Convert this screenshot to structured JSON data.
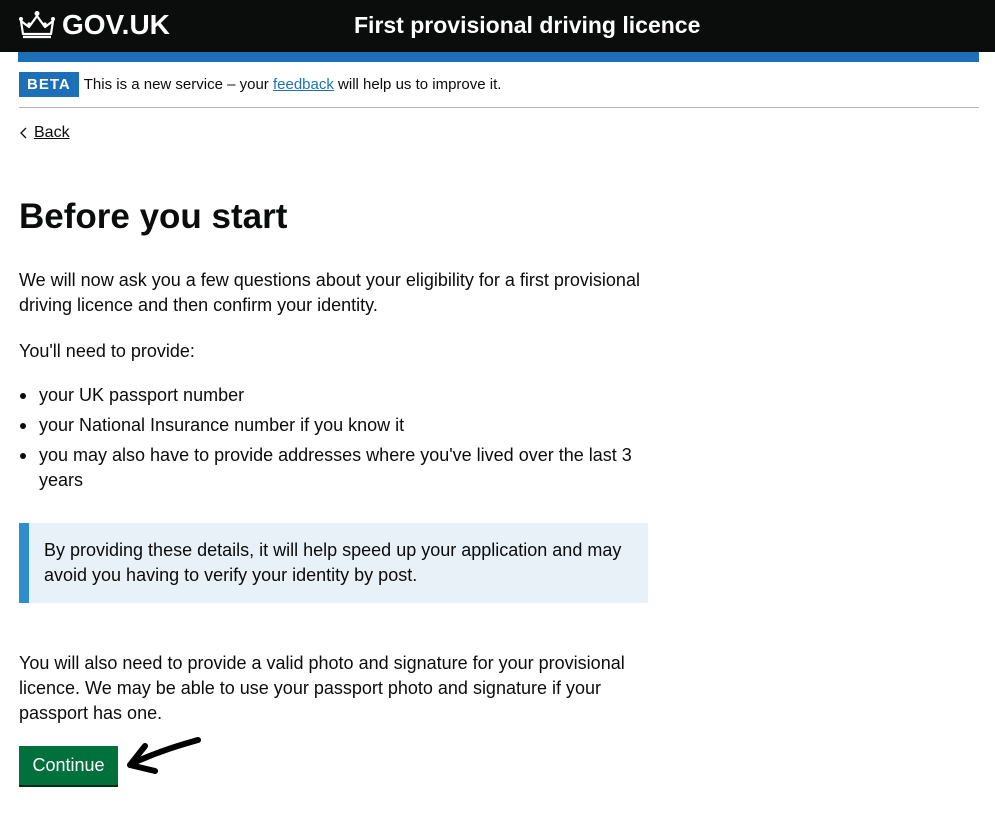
{
  "header": {
    "logo_text": "GOV.UK",
    "service_name": "First provisional driving licence",
    "crown_icon": "crown-icon"
  },
  "phase_banner": {
    "tag": "BETA",
    "text_before": "This is a new service – your ",
    "link_text": "feedback",
    "text_after": " will help us to improve it."
  },
  "back_link": {
    "label": "Back",
    "icon": "chevron-left-icon"
  },
  "main": {
    "heading": "Before you start",
    "intro": "We will now ask you a few questions about your eligibility for a first provisional driving licence and then confirm your identity.",
    "need_to_provide": "You'll need to provide:",
    "list": [
      "your UK passport number",
      "your National Insurance number if you know it",
      "you may also have to provide addresses where you've lived over the last 3 years"
    ],
    "inset": "By providing these details, it will help speed up your application and may avoid you having to verify your identity by post.",
    "photo_para": "You will also need to provide a valid photo and signature for your provisional licence. We may be able to use your passport photo and signature if your passport has one.",
    "continue_label": "Continue"
  },
  "annotation": {
    "icon": "hand-drawn-arrow-icon"
  },
  "colors": {
    "header_bg": "#0b0c0c",
    "brand_blue": "#1d70b8",
    "inset_border": "#2e8fcc",
    "inset_bg": "#e8f1f8",
    "button_green": "#00703c"
  }
}
